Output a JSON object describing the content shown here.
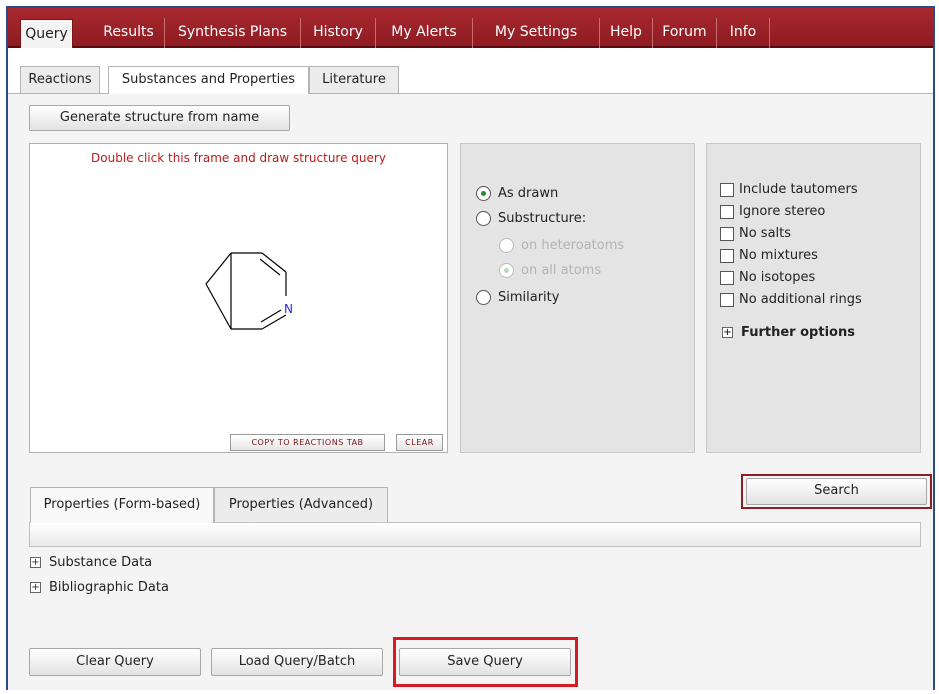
{
  "nav": {
    "tabs": [
      {
        "label": "Query"
      },
      {
        "label": "Results"
      },
      {
        "label": "Synthesis Plans"
      },
      {
        "label": "History"
      },
      {
        "label": "My Alerts"
      },
      {
        "label": "My Settings"
      },
      {
        "label": "Help"
      },
      {
        "label": "Forum"
      },
      {
        "label": "Info"
      }
    ]
  },
  "subtabs": [
    {
      "label": "Reactions"
    },
    {
      "label": "Substances and Properties"
    },
    {
      "label": "Literature"
    }
  ],
  "structure": {
    "generate_label": "Generate structure from name",
    "hint": "Double click this frame and draw structure query",
    "atom_label": "N",
    "copy_label": "COPY TO REACTIONS TAB",
    "clear_label": "CLEAR"
  },
  "search_mode": {
    "as_drawn": "As drawn",
    "substructure": "Substructure:",
    "on_heteroatoms": "on heteroatoms",
    "on_all_atoms": "on all atoms",
    "similarity": "Similarity",
    "selected": "As drawn"
  },
  "options": {
    "items": [
      {
        "label": "Include tautomers"
      },
      {
        "label": "Ignore stereo"
      },
      {
        "label": "No salts"
      },
      {
        "label": "No mixtures"
      },
      {
        "label": "No isotopes"
      },
      {
        "label": "No additional rings"
      }
    ],
    "further_label": "Further options"
  },
  "search_label": "Search",
  "property_tabs": [
    {
      "label": "Properties (Form-based)"
    },
    {
      "label": "Properties (Advanced)"
    }
  ],
  "tree": [
    {
      "label": "Substance Data"
    },
    {
      "label": "Bibliographic Data"
    }
  ],
  "footer": {
    "clear_label": "Clear Query",
    "load_label": "Load Query/Batch",
    "save_label": "Save Query"
  },
  "colors": {
    "nav_red": "#a8282e",
    "highlight_red": "#d61c22",
    "hint_red": "#b81c1c"
  }
}
